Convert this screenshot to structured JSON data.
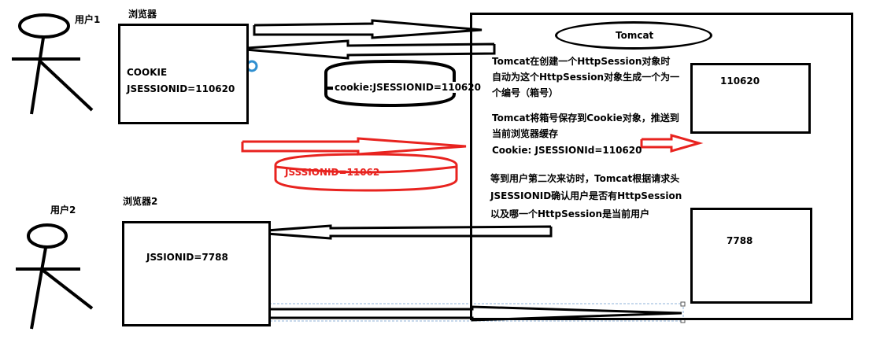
{
  "user1": {
    "label": "用户1"
  },
  "user2": {
    "label": "用户2"
  },
  "browser1": {
    "title": "浏览器",
    "cookie_label": "COOKIE",
    "session_value": "JSESSIONID=110620"
  },
  "browser2": {
    "title": "浏览器2",
    "session_value": "JSSIONID=7788"
  },
  "request_cookie": "cookie:JSESSIONID=110620",
  "red_request": "JSSSIONID=11062",
  "tomcat": {
    "title": "Tomcat",
    "note1_line1": "Tomcat在创建一个HttpSession对象时",
    "note1_line2": "自动为这个HttpSession对象生成一个为一",
    "note1_line3": "个编号（箱号）",
    "note2_line1": "Tomcat将箱号保存到Cookie对象，推送到",
    "note2_line2": "当前浏览器缓存",
    "note2_line3": "Cookie: JSESSIONId=110620",
    "note3_line1": "等到用户第二次来访时，Tomcat根据请求头",
    "note3_line2": "JSESSIONID确认用户是否有HttpSession",
    "note3_line3": "以及哪一个HttpSession是当前用户",
    "session1_id": "110620",
    "session2_id": "7788"
  },
  "colors": {
    "ink": "#000000",
    "red": "#e8231f",
    "selection": "#8fb3d9",
    "cursor": "#2f8fd0"
  }
}
